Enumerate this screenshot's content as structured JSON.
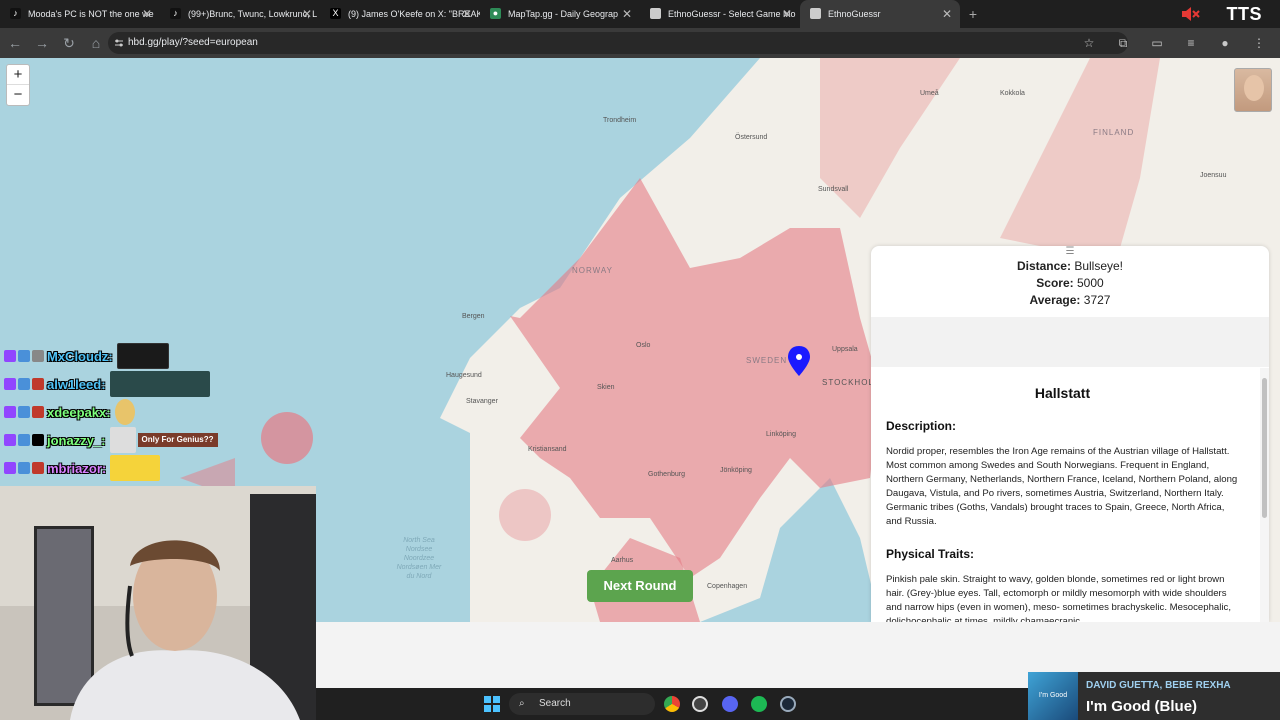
{
  "browser": {
    "tabs": [
      {
        "label": "Mooda's PC is NOT the one we",
        "icon": "tiktok-icon"
      },
      {
        "label": "(99+)Brunc, Twunc, Lowkrunc, L",
        "icon": "tiktok-icon"
      },
      {
        "label": "(9) James O'Keefe on X: \"BREAK",
        "icon": "x-icon"
      },
      {
        "label": "MapTap.gg - Daily Geograp",
        "icon": "maptap-icon"
      },
      {
        "label": "EthnoGuessr - Select Game Mo",
        "icon": "page-icon"
      },
      {
        "label": "EthnoGuessr",
        "icon": "page-icon"
      }
    ],
    "url": "hbd.gg/play/?seed=european",
    "overlay_text": "TTS"
  },
  "map": {
    "zoom_in": "+",
    "zoom_out": "−",
    "countries": [
      "NORWAY",
      "SWEDEN",
      "FINLAND",
      "STOCKHOLM"
    ],
    "places": [
      "Trondheim",
      "Östersund",
      "Umeå",
      "Kokkola",
      "Sundsvall",
      "Joensuu",
      "Bergen",
      "Oslo",
      "Uppsala",
      "Haugesund",
      "Skien",
      "Stavanger",
      "Linköping",
      "Kristiansand",
      "Jönköping",
      "Gothenburg",
      "Aarhus",
      "Copenhagen"
    ],
    "sea_label": "North Sea Nordsee Noordzee Nordsøen Mer du Nord",
    "next_round": "Next Round"
  },
  "result": {
    "distance_label": "Distance:",
    "distance_value": "Bullseye!",
    "score_label": "Score:",
    "score_value": "5000",
    "average_label": "Average:",
    "average_value": "3727",
    "title": "Hallstatt",
    "description_head": "Description:",
    "description": "Nordid proper, resembles the Iron Age remains of the Austrian village of Hallstatt. Most common among Swedes and South Norwegians. Frequent in England, Northern Germany, Netherlands, Northern France, Iceland, Northern Poland, along Daugava, Vistula, and Po rivers, sometimes Austria, Switzerland, Northern Italy. Germanic tribes (Goths, Vandals) brought traces to Spain, Greece, North Africa, and Russia.",
    "traits_head": "Physical Traits:",
    "traits": "Pinkish pale skin. Straight to wavy, golden blonde, sometimes red or light brown hair. (Grey-)blue eyes. Tall, ectomorph or mildly mesomorph with wide shoulders and narrow hips (even in women), meso- sometimes brachyskelic. Mesocephalic, dolichocephalic at times, mildly chamaecranic"
  },
  "chat": [
    {
      "user": "MxCloudz:",
      "color": "#4fc3f7",
      "emote": ""
    },
    {
      "user": "alw1leed:",
      "color": "#4fc3f7",
      "emote": ""
    },
    {
      "user": "xdeepakx:",
      "color": "#7cff7c",
      "emote": ""
    },
    {
      "user": "jonazzy_:",
      "color": "#7cff7c",
      "emote": "Only For Genius??"
    },
    {
      "user": "mbriazor:",
      "color": "#d880ff",
      "emote": ""
    }
  ],
  "taskbar": {
    "search": "Search"
  },
  "music": {
    "artist": "DAVID GUETTA, BEBE REXHA",
    "title": "I'm Good (Blue)",
    "art_text": "I'm Good"
  }
}
